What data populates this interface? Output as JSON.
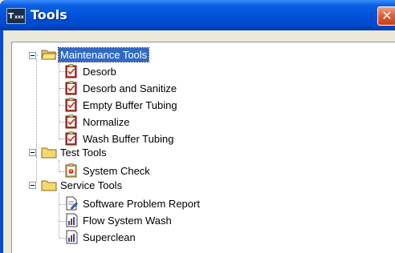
{
  "window": {
    "title": "Tools",
    "icon": "app-icon",
    "icon_text": "T",
    "icon_small": "xxx",
    "close_glyph": "✕"
  },
  "tree": {
    "groups": [
      {
        "label": "Maintenance Tools",
        "expanded": true,
        "selected": true,
        "items": [
          {
            "label": "Desorb",
            "icon": "clipboard-check-icon"
          },
          {
            "label": "Desorb and Sanitize",
            "icon": "clipboard-check-icon"
          },
          {
            "label": "Empty Buffer Tubing",
            "icon": "clipboard-check-icon"
          },
          {
            "label": "Normalize",
            "icon": "clipboard-check-icon"
          },
          {
            "label": "Wash Buffer Tubing",
            "icon": "clipboard-check-icon"
          }
        ]
      },
      {
        "label": "Test Tools",
        "expanded": true,
        "selected": false,
        "items": [
          {
            "label": "System Check",
            "icon": "clipboard-alert-icon"
          }
        ]
      },
      {
        "label": "Service Tools",
        "expanded": true,
        "selected": false,
        "items": [
          {
            "label": "Software Problem Report",
            "icon": "document-edit-icon"
          },
          {
            "label": "Flow System Wash",
            "icon": "bar-chart-icon"
          },
          {
            "label": "Superclean",
            "icon": "bar-chart-icon"
          }
        ]
      }
    ]
  },
  "colors": {
    "titlebar": "#0050d8",
    "selection": "#316ac5",
    "folder": "#f5d76e",
    "close": "#e0603a"
  }
}
